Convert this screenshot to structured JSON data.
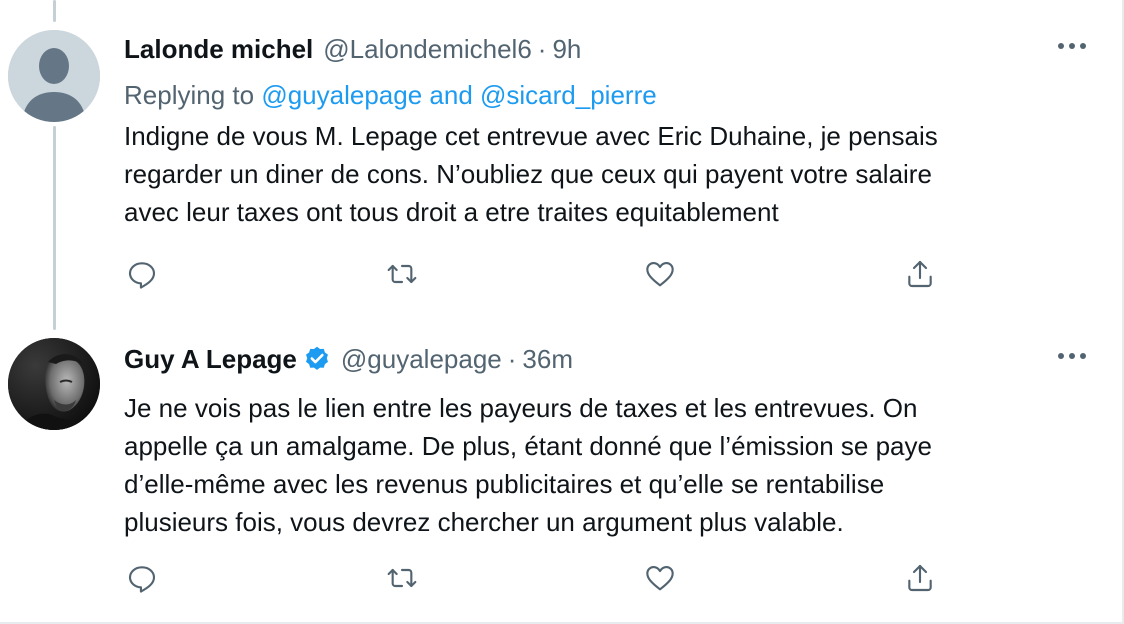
{
  "colors": {
    "link": "#1d9bf0",
    "secondary": "#536471",
    "text": "#0f1419",
    "verified": "#1d9bf0"
  },
  "tweets": [
    {
      "name": "Lalonde michel",
      "handle": "@Lalondemichel6",
      "separator": "·",
      "time": "9h",
      "verified": false,
      "reply": {
        "prefix": "Replying to ",
        "mention1": "@guyalepage",
        "joiner": " and ",
        "mention2": "@sicard_pierre"
      },
      "lines": [
        "Indigne de vous M. Lepage cet entrevue avec Eric Duhaine, je pensais",
        "regarder un diner de cons. N’oubliez que ceux qui payent votre salaire",
        "avec leur taxes ont tous droit a etre traites equitablement"
      ],
      "avatar_icon": "default-avatar-icon"
    },
    {
      "name": "Guy A Lepage",
      "handle": "@guyalepage",
      "separator": "·",
      "time": "36m",
      "verified": true,
      "lines": [
        "Je ne vois pas le lien entre les payeurs de taxes et les entrevues. On",
        "appelle ça un amalgame. De plus, étant donné que l’émission se paye",
        "d’elle-même avec les revenus publicitaires et qu’elle se rentabilise",
        "plusieurs fois, vous devrez chercher un argument plus valable."
      ],
      "avatar_icon": "profile-photo"
    }
  ],
  "action_icons": [
    "reply-icon",
    "retweet-icon",
    "like-icon",
    "share-icon"
  ]
}
